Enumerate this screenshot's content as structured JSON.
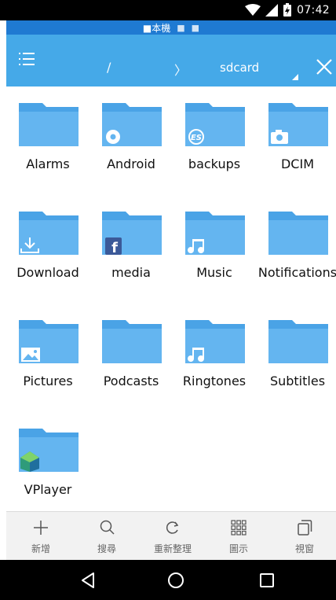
{
  "status_bar": {
    "time": "07:42"
  },
  "window_strip": {
    "title": "本機"
  },
  "toolbar": {
    "path_root": "/",
    "path_separator": "〉",
    "current_folder": "sdcard"
  },
  "folders": [
    {
      "name": "Alarms",
      "badge": ""
    },
    {
      "name": "Android",
      "badge": "gear-icon"
    },
    {
      "name": "backups",
      "badge": "es-icon"
    },
    {
      "name": "DCIM",
      "badge": "camera-icon"
    },
    {
      "name": "Download",
      "badge": "download-icon"
    },
    {
      "name": "media",
      "badge": "facebook-icon"
    },
    {
      "name": "Music",
      "badge": "music-note-icon"
    },
    {
      "name": "Notifications",
      "badge": ""
    },
    {
      "name": "Pictures",
      "badge": "image-icon"
    },
    {
      "name": "Podcasts",
      "badge": ""
    },
    {
      "name": "Ringtones",
      "badge": "music-note-icon"
    },
    {
      "name": "Subtitles",
      "badge": ""
    },
    {
      "name": "VPlayer",
      "badge": "vplayer-icon"
    }
  ],
  "action_bar": {
    "new_label": "新增",
    "search_label": "搜尋",
    "refresh_label": "重新整理",
    "view_label": "圖示",
    "window_label": "視窗"
  },
  "colors": {
    "toolbar": "#45a9e8",
    "window_strip": "#1f7ad2",
    "folder_body": "#64b5f0",
    "folder_tab": "#4aa3e6",
    "action_bar": "#f2f2f2"
  }
}
